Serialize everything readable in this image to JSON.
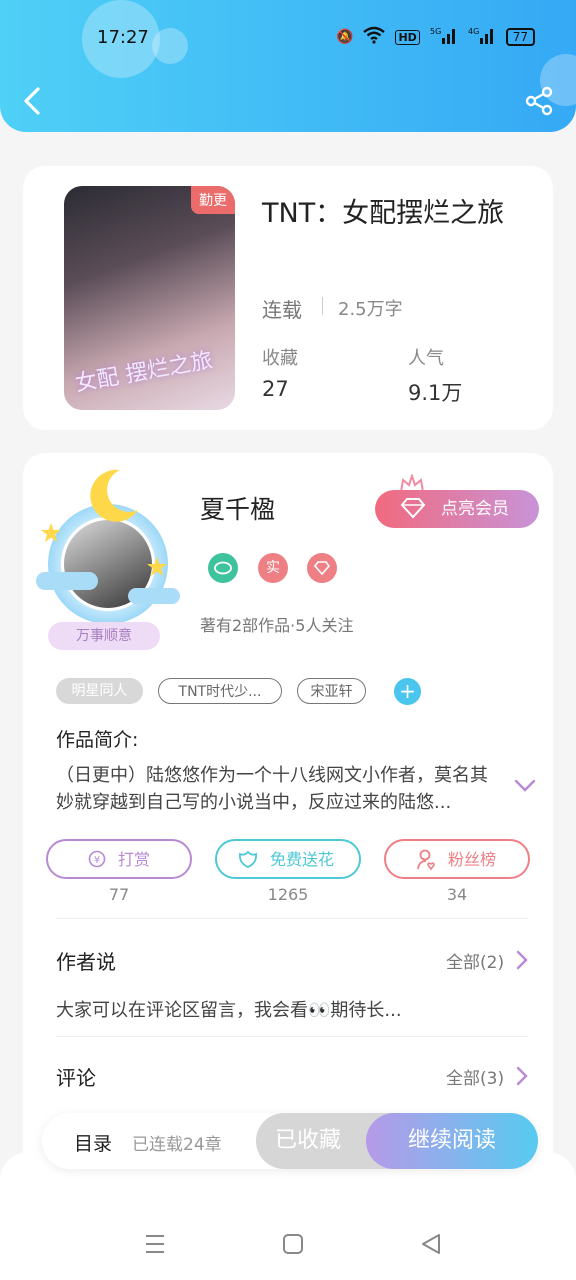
{
  "status": {
    "time": "17:27",
    "battery": "77"
  },
  "book": {
    "title": "TNT：女配摆烂之旅",
    "cover_badge": "勤更",
    "cover_text": "女配 摆烂之旅",
    "status": "连载",
    "words": "2.5万字",
    "collect_label": "收藏",
    "collect_value": "27",
    "popularity_label": "人气",
    "popularity_value": "9.1万"
  },
  "author": {
    "name": "夏千楹",
    "vip_label": "点亮会员",
    "motto": "万事顺意",
    "badge_real": "实",
    "works": "著有2部作品·5人关注"
  },
  "tags": [
    "明星同人",
    "TNT时代少...",
    "宋亚轩"
  ],
  "intro": {
    "title": "作品简介:",
    "text": "（日更中）陆悠悠作为一个十八线网文小作者，莫名其妙就穿越到自己写的小说当中，反应过来的陆悠..."
  },
  "actions": [
    {
      "label": "打赏",
      "count": "77",
      "color": "#b88ad4"
    },
    {
      "label": "免费送花",
      "count": "1265",
      "color": "#4fc8d6"
    },
    {
      "label": "粉丝榜",
      "count": "34",
      "color": "#ee7f84"
    }
  ],
  "author_say": {
    "title": "作者说",
    "all": "全部(2)",
    "text": "大家可以在评论区留言，我会看👀期待长..."
  },
  "comments": {
    "title": "评论",
    "all": "全部(3)"
  },
  "read_bar": {
    "toc": "目录",
    "toc_count": "已连载24章",
    "saved": "已收藏",
    "continue": "继续阅读"
  }
}
